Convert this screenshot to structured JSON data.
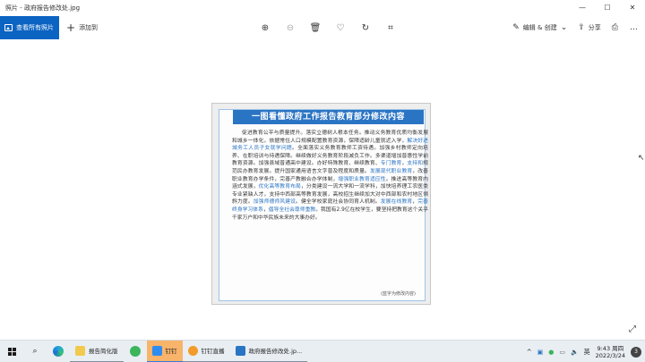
{
  "window": {
    "title": "照片 - 政府报告修改处.jpg",
    "controls": {
      "minimize": "—",
      "maximize": "☐",
      "close": "✕"
    }
  },
  "toolbar": {
    "all_photos_label": "查看所有照片",
    "add_label": "添加到",
    "add_icon": "+",
    "zoom_in_icon": "⊕",
    "zoom_out_icon": "⊖",
    "delete_icon": "🗑",
    "favorite_icon": "♡",
    "rotate_icon": "↻",
    "crop_icon": "⌗",
    "edit_create_label": "编辑 & 创建",
    "edit_icon": "✎",
    "share_label": "分享",
    "share_icon": "⇪",
    "print_icon": "⎙",
    "more_icon": "…"
  },
  "document": {
    "title": "一图看懂政府工作报告教育部分修改内容",
    "segments": [
      {
        "text": "促进教育公平与质量提升。落实立德树人根本任务。推动义务教育优质均衡发展和城乡一体化，依据常住人口规模配置教育资源，保障适龄儿童就近入学，",
        "hl": false
      },
      {
        "text": "解决好进城务工人员子女就学问题",
        "hl": true
      },
      {
        "text": "。全面落实义务教育教师工资待遇。加强乡村教师定向培养、在职培训与待遇保障。继续做好义务教育阶段减负工作。多渠道增加普惠性学前教育资源。加强县域普通高中建设。办好特殊教育、继续教育、",
        "hl": false
      },
      {
        "text": "专门教育",
        "hl": true
      },
      {
        "text": "，",
        "hl": false
      },
      {
        "text": "支持和",
        "hl": true
      },
      {
        "text": "规范民办教育发展。提升国家通用语言文字普及程度和质量。",
        "hl": false
      },
      {
        "text": "发展现代职业教育",
        "hl": true
      },
      {
        "text": "，改善职业教育办学条件，完善产教融合办学体制，",
        "hl": false
      },
      {
        "text": "增强职业教育适应性",
        "hl": true
      },
      {
        "text": "。推进高等教育内涵式发展，",
        "hl": false
      },
      {
        "text": "优化高等教育布局",
        "hl": true
      },
      {
        "text": "，分类建设一流大学和一流学科，加快培养理工农医类专业紧缺人才，支持中西部高等教育发展，高校招生继续加大对中西部和农村地区倾斜力度。",
        "hl": false
      },
      {
        "text": "加强师德师风建设",
        "hl": true
      },
      {
        "text": "。健全学校家庭社会协同育人机制。",
        "hl": false
      },
      {
        "text": "发展在线教育",
        "hl": true
      },
      {
        "text": "，",
        "hl": false
      },
      {
        "text": "完善终身学习体系",
        "hl": true
      },
      {
        "text": "，",
        "hl": false
      },
      {
        "text": "倡导全社会尊师重教",
        "hl": true
      },
      {
        "text": "。我国有2.9亿在校学生，要坚持把教育这个关乎千家万户和中华民族未来的大事办好。",
        "hl": false
      }
    ],
    "note": "(蓝字为修改内容)"
  },
  "taskbar": {
    "search_icon": "⌕",
    "apps": [
      {
        "label": "报告简化版"
      },
      {
        "label": "钉钉"
      },
      {
        "label": "钉钉直播"
      },
      {
        "label": "政府报告修改处.jp..."
      }
    ],
    "tray": {
      "chevron": "^",
      "volume_icon": "🔈",
      "ime": "英",
      "time": "9:43 周四",
      "date": "2022/3/24",
      "notifications": "3"
    }
  },
  "colors": {
    "accent": "#0b63c2",
    "doc_title_bg": "#2a74c4",
    "highlight_text": "#2a74c4",
    "active_task": "#f7b46a"
  }
}
